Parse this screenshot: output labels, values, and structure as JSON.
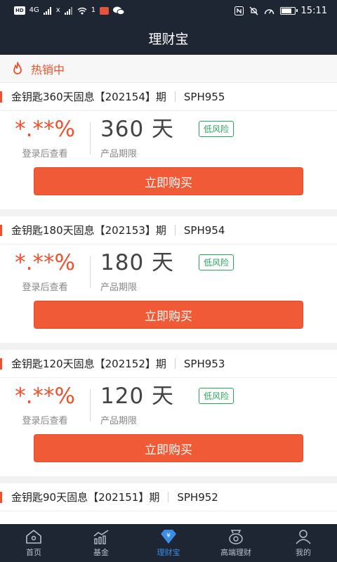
{
  "status_bar": {
    "hd_badge": "HD",
    "signal_1": "4G",
    "signal_2": "x",
    "wifi_sup": "1",
    "time": "15:11"
  },
  "nav": {
    "title": "理财宝"
  },
  "section": {
    "hot_label": "热销中"
  },
  "products": [
    {
      "name": "金钥匙360天固息【202154】期",
      "code": "SPH955",
      "rate": "*.**%",
      "rate_hint": "登录后查看",
      "term": "360 天",
      "term_label": "产品期限",
      "risk": "低风险",
      "buy_label": "立即购买"
    },
    {
      "name": "金钥匙180天固息【202153】期",
      "code": "SPH954",
      "rate": "*.**%",
      "rate_hint": "登录后查看",
      "term": "180 天",
      "term_label": "产品期限",
      "risk": "低风险",
      "buy_label": "立即购买"
    },
    {
      "name": "金钥匙120天固息【202152】期",
      "code": "SPH953",
      "rate": "*.**%",
      "rate_hint": "登录后查看",
      "term": "120 天",
      "term_label": "产品期限",
      "risk": "低风险",
      "buy_label": "立即购买"
    },
    {
      "name": "金钥匙90天固息【202151】期",
      "code": "SPH952"
    }
  ],
  "tabs": [
    {
      "label": "首页",
      "icon": "home-icon"
    },
    {
      "label": "基金",
      "icon": "chart-icon"
    },
    {
      "label": "理财宝",
      "icon": "diamond-icon"
    },
    {
      "label": "高端理财",
      "icon": "bag-icon"
    },
    {
      "label": "我的",
      "icon": "user-icon"
    }
  ],
  "colors": {
    "accent": "#f0502b",
    "button": "#f15a36",
    "risk": "#2aa55b",
    "bar": "#1e2533",
    "tab_active": "#3a8ee6"
  },
  "battery_level": 0.85
}
